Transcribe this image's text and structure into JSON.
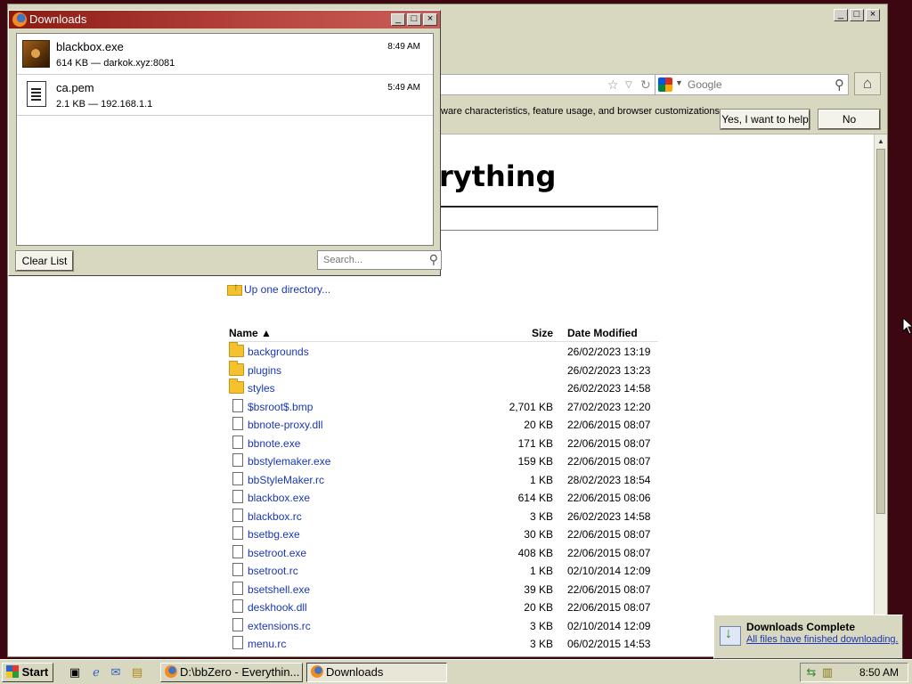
{
  "browser": {
    "search_placeholder": "Google",
    "notify_message": "ware characteristics, feature usage, and browser customizations",
    "yes_label": "Yes, I want to help",
    "no_label": "No",
    "page_heading": "rything",
    "up_dir_label": "Up one directory...",
    "listing": {
      "headers": {
        "name": "Name ▲",
        "size": "Size",
        "date": "Date Modified"
      },
      "rows": [
        {
          "name": "backgrounds",
          "size": "",
          "date": "26/02/2023 13:19",
          "type": "folder"
        },
        {
          "name": "plugins",
          "size": "",
          "date": "26/02/2023 13:23",
          "type": "folder"
        },
        {
          "name": "styles",
          "size": "",
          "date": "26/02/2023 14:58",
          "type": "folder"
        },
        {
          "name": "$bsroot$.bmp",
          "size": "2,701 KB",
          "date": "27/02/2023 12:20",
          "type": "file"
        },
        {
          "name": "bbnote-proxy.dll",
          "size": "20 KB",
          "date": "22/06/2015 08:07",
          "type": "file"
        },
        {
          "name": "bbnote.exe",
          "size": "171 KB",
          "date": "22/06/2015 08:07",
          "type": "file"
        },
        {
          "name": "bbstylemaker.exe",
          "size": "159 KB",
          "date": "22/06/2015 08:07",
          "type": "file"
        },
        {
          "name": "bbStyleMaker.rc",
          "size": "1 KB",
          "date": "28/02/2023 18:54",
          "type": "file"
        },
        {
          "name": "blackbox.exe",
          "size": "614 KB",
          "date": "22/06/2015 08:06",
          "type": "file"
        },
        {
          "name": "blackbox.rc",
          "size": "3 KB",
          "date": "26/02/2023 14:58",
          "type": "file"
        },
        {
          "name": "bsetbg.exe",
          "size": "30 KB",
          "date": "22/06/2015 08:07",
          "type": "file"
        },
        {
          "name": "bsetroot.exe",
          "size": "408 KB",
          "date": "22/06/2015 08:07",
          "type": "file"
        },
        {
          "name": "bsetroot.rc",
          "size": "1 KB",
          "date": "02/10/2014 12:09",
          "type": "file"
        },
        {
          "name": "bsetshell.exe",
          "size": "39 KB",
          "date": "22/06/2015 08:07",
          "type": "file"
        },
        {
          "name": "deskhook.dll",
          "size": "20 KB",
          "date": "22/06/2015 08:07",
          "type": "file"
        },
        {
          "name": "extensions.rc",
          "size": "3 KB",
          "date": "02/10/2014 12:09",
          "type": "file"
        },
        {
          "name": "menu.rc",
          "size": "3 KB",
          "date": "06/02/2015 14:53",
          "type": "file"
        }
      ]
    }
  },
  "downloads": {
    "title": "Downloads",
    "items": [
      {
        "name": "blackbox.exe",
        "meta": "614 KB — darkok.xyz:8081",
        "time": "8:49 AM"
      },
      {
        "name": "ca.pem",
        "meta": "2.1 KB — 192.168.1.1",
        "time": "5:49 AM"
      }
    ],
    "clear_label": "Clear List",
    "search_placeholder": "Search..."
  },
  "toast": {
    "title": "Downloads Complete",
    "message": "All files have finished downloading."
  },
  "taskbar": {
    "start_label": "Start",
    "tasks": [
      {
        "label": "D:\\bbZero - Everythin..."
      },
      {
        "label": "Downloads"
      }
    ],
    "clock": "8:50 AM"
  },
  "colors": {
    "desktop": "#3c0710",
    "title_gradient_start": "#8b1a12",
    "link": "#1a37b7"
  }
}
